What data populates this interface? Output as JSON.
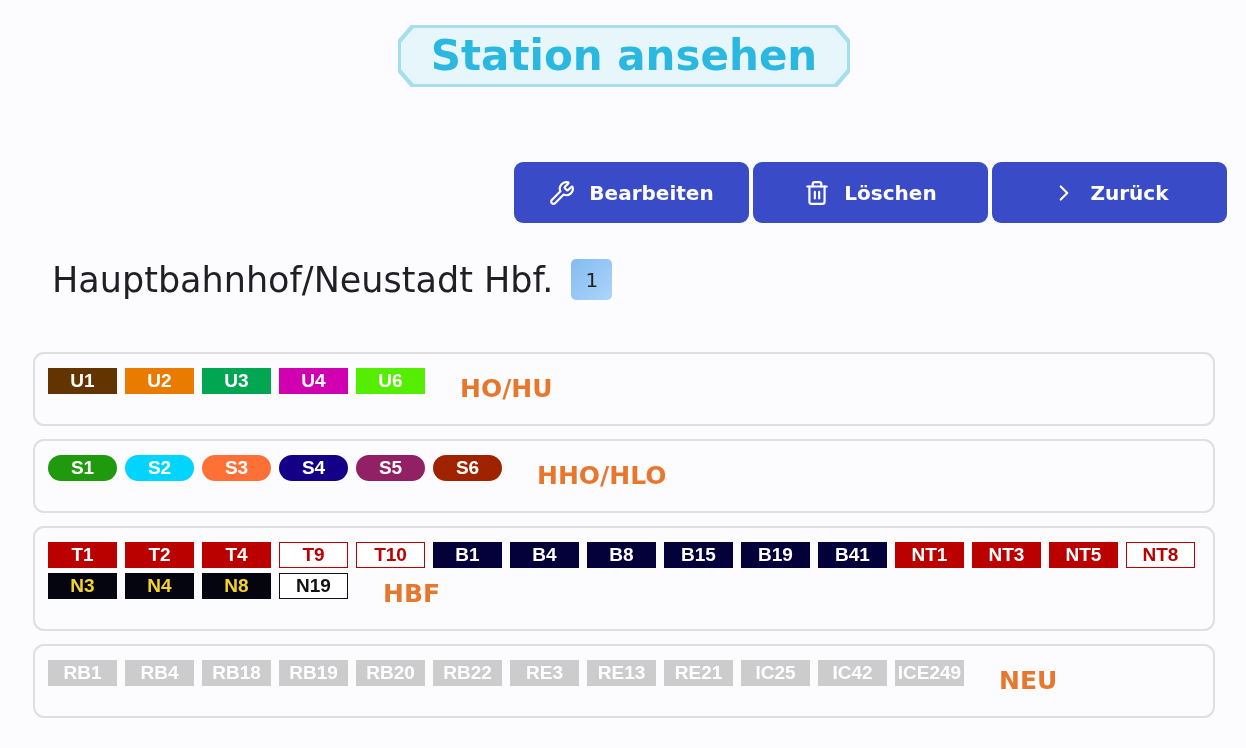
{
  "title": "Station ansehen",
  "actions": [
    {
      "kind": "edit",
      "label": "Bearbeiten"
    },
    {
      "kind": "delete",
      "label": "Löschen"
    },
    {
      "kind": "back",
      "label": "Zurück"
    }
  ],
  "station": {
    "name": "Hauptbahnhof/Neustadt Hbf.",
    "badge": "1"
  },
  "groups": [
    {
      "label": "HO/HU",
      "lines": [
        {
          "kind": "block",
          "color": "#633400",
          "label": {
            "text": "U1",
            "color": "#ffffff"
          }
        },
        {
          "kind": "block",
          "color": "#e87b00",
          "label": {
            "text": "U2",
            "color": "#ffffff"
          }
        },
        {
          "kind": "block",
          "color": "#00a651",
          "label": {
            "text": "U3",
            "color": "#ffffff"
          }
        },
        {
          "kind": "block",
          "color": "#d000b0",
          "label": {
            "text": "U4",
            "color": "#ffffff"
          }
        },
        {
          "kind": "block",
          "color": "#55ee00",
          "label": {
            "text": "U6",
            "color": "#ffffff"
          }
        }
      ]
    },
    {
      "label": "HHO/HLO",
      "lines": [
        {
          "kind": "pill",
          "color": "#1e9a0c",
          "label": {
            "text": "S1",
            "color": "#ffffff"
          }
        },
        {
          "kind": "pill",
          "color": "#00d4ff",
          "label": {
            "text": "S2",
            "color": "#ffffff"
          }
        },
        {
          "kind": "pill",
          "color": "#ff7037",
          "label": {
            "text": "S3",
            "color": "#ffffff"
          }
        },
        {
          "kind": "pill",
          "color": "#130087",
          "label": {
            "text": "S4",
            "color": "#ffffff"
          }
        },
        {
          "kind": "pill",
          "color": "#922065",
          "label": {
            "text": "S5",
            "color": "#ffffff"
          }
        },
        {
          "kind": "pill",
          "color": "#a02300",
          "label": {
            "text": "S6",
            "color": "#ffffff"
          }
        }
      ]
    },
    {
      "label": "HBF",
      "lines": [
        {
          "kind": "block",
          "color": "#bb0000",
          "label": {
            "text": "T1",
            "color": "#ffffff"
          }
        },
        {
          "kind": "block",
          "color": "#bb0000",
          "label": {
            "text": "T2",
            "color": "#ffffff"
          }
        },
        {
          "kind": "block",
          "color": "#bb0000",
          "label": {
            "text": "T4",
            "color": "#ffffff"
          }
        },
        {
          "kind": "outline",
          "color": "#bb0000",
          "label": {
            "text": "T9",
            "color": "#bb0000"
          }
        },
        {
          "kind": "outline",
          "color": "#bb0000",
          "label": {
            "text": "T10",
            "color": "#bb0000"
          }
        },
        {
          "kind": "block",
          "color": "#03003a",
          "label": {
            "text": "B1",
            "color": "#ffffff"
          }
        },
        {
          "kind": "block",
          "color": "#03003a",
          "label": {
            "text": "B4",
            "color": "#ffffff"
          }
        },
        {
          "kind": "block",
          "color": "#03003a",
          "label": {
            "text": "B8",
            "color": "#ffffff"
          }
        },
        {
          "kind": "block",
          "color": "#03003a",
          "label": {
            "text": "B15",
            "color": "#ffffff"
          }
        },
        {
          "kind": "block",
          "color": "#03003a",
          "label": {
            "text": "B19",
            "color": "#ffffff"
          }
        },
        {
          "kind": "block",
          "color": "#03003a",
          "label": {
            "text": "B41",
            "color": "#ffffff"
          }
        },
        {
          "kind": "block",
          "color": "#bb0000",
          "label": {
            "text": "NT1",
            "color": "#ffffff"
          }
        },
        {
          "kind": "block",
          "color": "#bb0000",
          "label": {
            "text": "NT3",
            "color": "#ffffff"
          }
        },
        {
          "kind": "block",
          "color": "#bb0000",
          "label": {
            "text": "NT5",
            "color": "#ffffff"
          }
        },
        {
          "kind": "outline",
          "color": "#bb0000",
          "label": {
            "text": "NT8",
            "color": "#bb0000"
          }
        },
        {
          "kind": "block",
          "color": "#05050f",
          "label": {
            "text": "N3",
            "color": "#f5d42a"
          }
        },
        {
          "kind": "block",
          "color": "#05050f",
          "label": {
            "text": "N4",
            "color": "#f5d42a"
          }
        },
        {
          "kind": "block",
          "color": "#05050f",
          "label": {
            "text": "N8",
            "color": "#f5d42a"
          }
        },
        {
          "kind": "outline",
          "color": "#111111",
          "label": {
            "text": "N19",
            "color": "#111111"
          }
        }
      ]
    },
    {
      "label": "NEU",
      "lines": [
        {
          "kind": "block",
          "color": "#cccccc",
          "label": {
            "text": "RB1",
            "color": "#ffffff"
          }
        },
        {
          "kind": "block",
          "color": "#cccccc",
          "label": {
            "text": "RB4",
            "color": "#ffffff"
          }
        },
        {
          "kind": "block",
          "color": "#cccccc",
          "label": {
            "text": "RB18",
            "color": "#ffffff"
          }
        },
        {
          "kind": "block",
          "color": "#cccccc",
          "label": {
            "text": "RB19",
            "color": "#ffffff"
          }
        },
        {
          "kind": "block",
          "color": "#cccccc",
          "label": {
            "text": "RB20",
            "color": "#ffffff"
          }
        },
        {
          "kind": "block",
          "color": "#cccccc",
          "label": {
            "text": "RB22",
            "color": "#ffffff"
          }
        },
        {
          "kind": "block",
          "color": "#cccccc",
          "label": {
            "text": "RE3",
            "color": "#ffffff"
          }
        },
        {
          "kind": "block",
          "color": "#cccccc",
          "label": {
            "text": "RE13",
            "color": "#ffffff"
          }
        },
        {
          "kind": "block",
          "color": "#cccccc",
          "label": {
            "text": "RE21",
            "color": "#ffffff"
          }
        },
        {
          "kind": "block",
          "color": "#cccccc",
          "label": {
            "text": "IC25",
            "color": "#ffffff"
          }
        },
        {
          "kind": "block",
          "color": "#cccccc",
          "label": {
            "text": "IC42",
            "color": "#ffffff"
          }
        },
        {
          "kind": "block",
          "color": "#cccccc",
          "label": {
            "text": "ICE249",
            "color": "#ffffff"
          }
        }
      ]
    }
  ]
}
